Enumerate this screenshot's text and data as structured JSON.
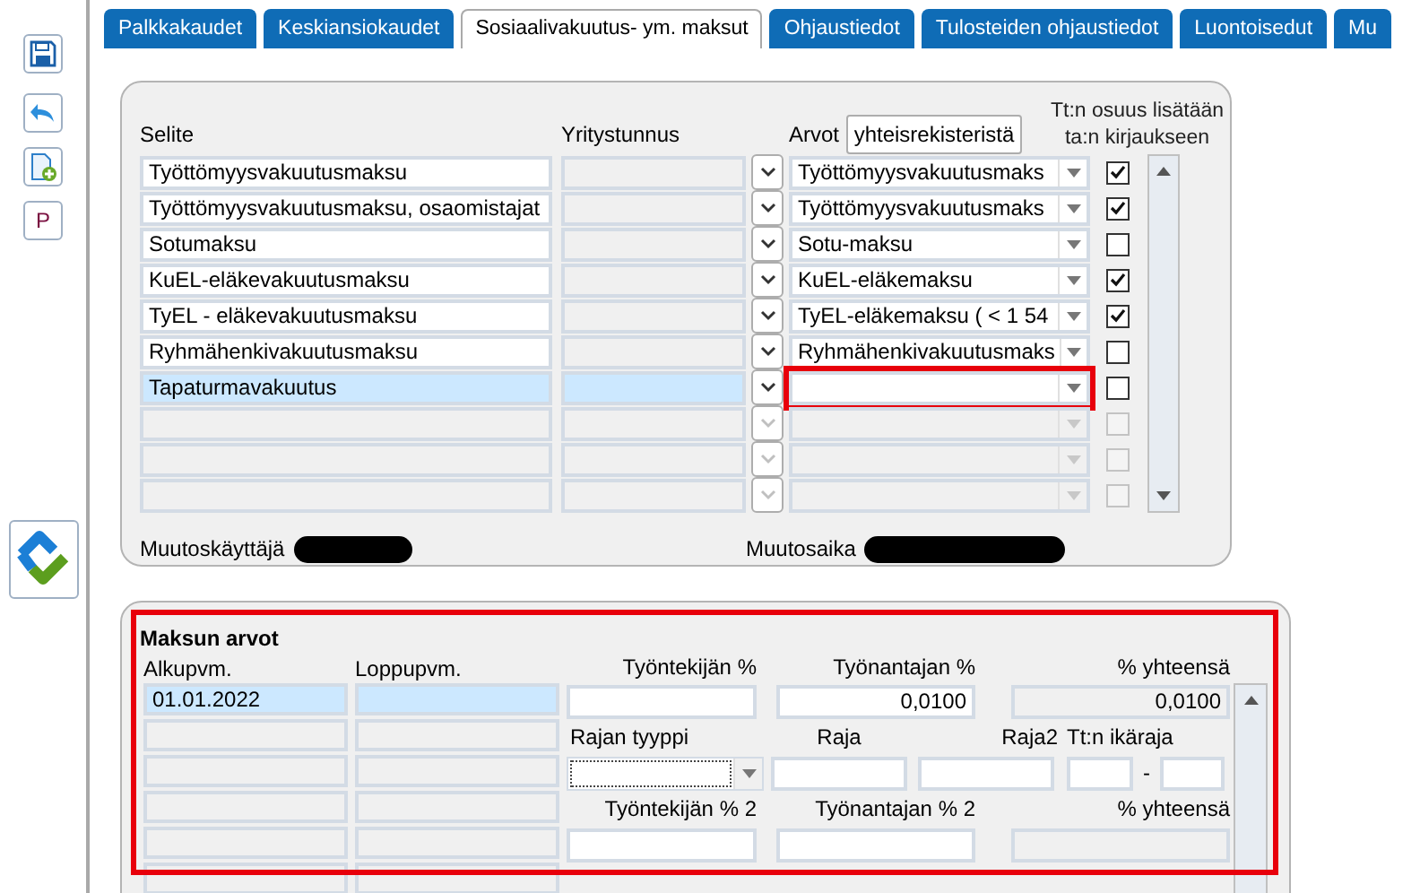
{
  "toolbar": {
    "print_button": "P"
  },
  "tabs": [
    {
      "label": "Palkkakaudet",
      "selected": false
    },
    {
      "label": "Keskiansiokaudet",
      "selected": false
    },
    {
      "label": "Sosiaalivakuutus- ym. maksut",
      "selected": true
    },
    {
      "label": "Ohjaustiedot",
      "selected": false
    },
    {
      "label": "Tulosteiden ohjaustiedot",
      "selected": false
    },
    {
      "label": "Luontoisedut",
      "selected": false
    },
    {
      "label": "Mu",
      "selected": false
    }
  ],
  "payments": {
    "columns": {
      "description": "Selite",
      "business_id": "Yritystunnus",
      "values": "Arvot",
      "added_to_employer": [
        "Tt:n osuus lisätään",
        "ta:n kirjaukseen"
      ]
    },
    "registry_button": "yhteisrekisteristä",
    "rows": [
      {
        "description": "Työttömyysvakuutusmaksu",
        "value": "Työttömyysvakuutusmaks",
        "checked": true,
        "selected": false,
        "enabled": true,
        "highlighted": false
      },
      {
        "description": "Työttömyysvakuutusmaksu, osaomistajat",
        "value": "Työttömyysvakuutusmaks",
        "checked": true,
        "selected": false,
        "enabled": true,
        "highlighted": false
      },
      {
        "description": "Sotumaksu",
        "value": "Sotu-maksu",
        "checked": false,
        "selected": false,
        "enabled": true,
        "highlighted": false
      },
      {
        "description": "KuEL-eläkevakuutusmaksu",
        "value": "KuEL-eläkemaksu",
        "checked": true,
        "selected": false,
        "enabled": true,
        "highlighted": false
      },
      {
        "description": "TyEL - eläkevakuutusmaksu",
        "value": "TyEL-eläkemaksu ( < 1 54",
        "checked": true,
        "selected": false,
        "enabled": true,
        "highlighted": false
      },
      {
        "description": "Ryhmähenkivakuutusmaksu",
        "value": "Ryhmähenkivakuutusmaks",
        "checked": false,
        "selected": false,
        "enabled": true,
        "highlighted": false
      },
      {
        "description": "Tapaturmavakuutus",
        "checked": false,
        "selected": true,
        "enabled": true,
        "highlighted": true
      },
      {
        "checked": false,
        "selected": false,
        "enabled": false,
        "highlighted": false
      },
      {
        "checked": false,
        "selected": false,
        "enabled": false,
        "highlighted": false
      },
      {
        "checked": false,
        "selected": false,
        "enabled": false,
        "highlighted": false
      }
    ],
    "changed_by": {
      "label": "Muutoskäyttäjä",
      "redacted": true
    },
    "changed_at": {
      "label": "Muutosaika",
      "redacted": true
    }
  },
  "payment_values": {
    "title": "Maksun arvot",
    "highlighted": true,
    "columns": {
      "start": "Alkupvm.",
      "end": "Loppupvm."
    },
    "rows": [
      {
        "start": "01.01.2022",
        "selected": true
      },
      {
        "selected": false
      },
      {
        "selected": false
      },
      {
        "selected": false
      },
      {
        "selected": false
      },
      {
        "selected": false
      }
    ],
    "employee_pct": {
      "label": "Työntekijän %"
    },
    "employer_pct": {
      "label": "Työnantajan %",
      "value": "0,0100"
    },
    "total_pct": {
      "label": "% yhteensä",
      "value": "0,0100"
    },
    "limit_type": {
      "label": "Rajan tyyppi"
    },
    "limit": {
      "label": "Raja"
    },
    "limit2": {
      "label": "Raja2"
    },
    "age_limit": {
      "label": "Tt:n ikäraja",
      "separator": "-"
    },
    "employee_pct2": {
      "label": "Työntekijän % 2"
    },
    "employer_pct2": {
      "label": "Työnantajan % 2"
    },
    "total_pct2": {
      "label": "% yhteensä"
    }
  }
}
